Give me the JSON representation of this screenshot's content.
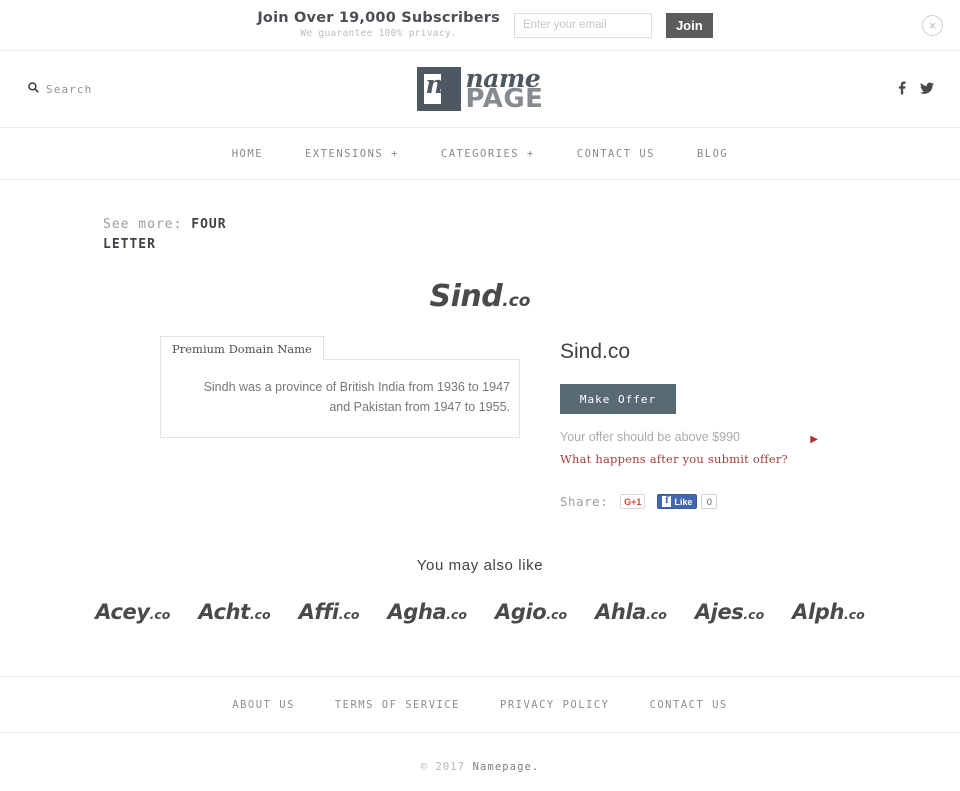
{
  "subscribe_bar": {
    "headline": "Join Over 19,000 Subscribers",
    "subtext": "We guarantee 100% privacy.",
    "email_placeholder": "Enter your email",
    "email_value": "",
    "join_label": "Join",
    "close_icon": "×"
  },
  "header": {
    "search_label": "Search",
    "search_icon": "⌕",
    "logo": {
      "mark_letter": "n",
      "word_top": "name",
      "word_bottom": "PAGE"
    },
    "socials": [
      {
        "name": "facebook",
        "glyph": "f"
      },
      {
        "name": "twitter",
        "glyph": "🐦"
      }
    ]
  },
  "nav": {
    "items": [
      {
        "label": "HOME"
      },
      {
        "label": "EXTENSIONS +"
      },
      {
        "label": "CATEGORIES +"
      },
      {
        "label": "CONTACT US"
      },
      {
        "label": "BLOG"
      }
    ]
  },
  "see_more": {
    "prefix": "See more:",
    "category": "FOUR LETTER"
  },
  "hero": {
    "name": "Sind",
    "tld": ".co"
  },
  "description": {
    "tab_label": "Premium Domain Name",
    "text": "Sindh was a province of British India from 1936 to 1947 and Pakistan from 1947 to 1955."
  },
  "offer_panel": {
    "domain_title": "Sind.co",
    "make_offer_label": "Make Offer",
    "minimum_text": "Your offer should be above $990",
    "minimum_price": "$990",
    "arrow_icon": "▶",
    "help_link": "What happens after you submit offer?",
    "share_label": "Share:",
    "gplus_label": "G+1",
    "facebook_like_label": "Like",
    "facebook_count": "0"
  },
  "also_like": {
    "title": "You may also like",
    "items": [
      {
        "name": "Acey",
        "tld": ".co"
      },
      {
        "name": "Acht",
        "tld": ".co"
      },
      {
        "name": "Affi",
        "tld": ".co"
      },
      {
        "name": "Agha",
        "tld": ".co"
      },
      {
        "name": "Agio",
        "tld": ".co"
      },
      {
        "name": "Ahla",
        "tld": ".co"
      },
      {
        "name": "Ajes",
        "tld": ".co"
      },
      {
        "name": "Alph",
        "tld": ".co"
      }
    ]
  },
  "footer": {
    "links": [
      {
        "label": "ABOUT US"
      },
      {
        "label": "TERMS OF SERVICE"
      },
      {
        "label": "PRIVACY POLICY"
      },
      {
        "label": "CONTACT US"
      }
    ],
    "copyright_prefix": "© 2017 ",
    "copyright_brand": "Namepage."
  },
  "colors": {
    "logo_dark": "#4e5862",
    "logo_gray": "#868b90",
    "make_offer_bg": "#5a6a75",
    "join_bg": "#5c5c5c",
    "accent_red": "#a33f3f",
    "facebook_blue": "#4267b2",
    "gplus_red": "#d64937"
  }
}
